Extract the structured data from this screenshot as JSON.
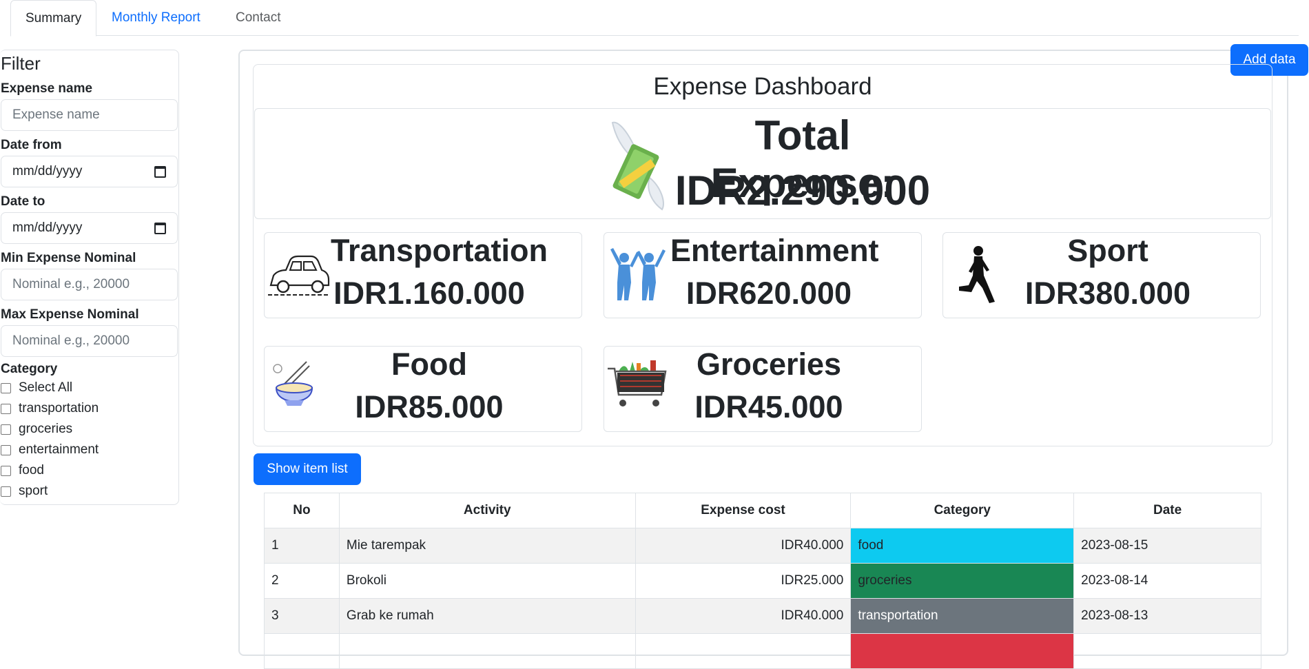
{
  "tabs": [
    {
      "label": "Summary"
    },
    {
      "label": "Monthly Report"
    },
    {
      "label": "Contact"
    }
  ],
  "filter": {
    "title": "Filter",
    "expense_name_label": "Expense name",
    "expense_name_placeholder": "Expense name",
    "date_from_label": "Date from",
    "date_from_value": "mm/dd/yyyy",
    "date_to_label": "Date to",
    "date_to_value": "mm/dd/yyyy",
    "min_label": "Min Expense Nominal",
    "min_placeholder": "Nominal e.g., 20000",
    "max_label": "Max Expense Nominal",
    "max_placeholder": "Nominal e.g., 20000",
    "category_label": "Category",
    "categories": [
      "Select All",
      "transportation",
      "groceries",
      "entertainment",
      "food",
      "sport"
    ]
  },
  "add_button": "Add data",
  "dashboard": {
    "title": "Expense Dashboard",
    "total_label": "Total Expense:",
    "total_value": "IDR2.290.000",
    "cards": [
      {
        "name": "Transportation",
        "value": "IDR1.160.000",
        "icon": "car-icon"
      },
      {
        "name": "Entertainment",
        "value": "IDR620.000",
        "icon": "people-celebrating-icon"
      },
      {
        "name": "Sport",
        "value": "IDR380.000",
        "icon": "runner-icon"
      },
      {
        "name": "Food",
        "value": "IDR85.000",
        "icon": "noodle-bowl-icon"
      },
      {
        "name": "Groceries",
        "value": "IDR45.000",
        "icon": "shopping-cart-icon"
      }
    ]
  },
  "show_button": "Show item list",
  "table": {
    "headers": [
      "No",
      "Activity",
      "Expense cost",
      "Category",
      "Date"
    ],
    "rows": [
      {
        "no": "1",
        "activity": "Mie tarempak",
        "cost": "IDR40.000",
        "category": "food",
        "date": "2023-08-15"
      },
      {
        "no": "2",
        "activity": "Brokoli",
        "cost": "IDR25.000",
        "category": "groceries",
        "date": "2023-08-14"
      },
      {
        "no": "3",
        "activity": "Grab ke rumah",
        "cost": "IDR40.000",
        "category": "transportation",
        "date": "2023-08-13"
      },
      {
        "no": "",
        "activity": "",
        "cost": "",
        "category": "",
        "date": ""
      }
    ]
  },
  "colors": {
    "primary": "#0d6efd",
    "food": "#0dcaf0",
    "groceries": "#198754",
    "transportation": "#6c757d",
    "entertainment": "#dc3545"
  }
}
